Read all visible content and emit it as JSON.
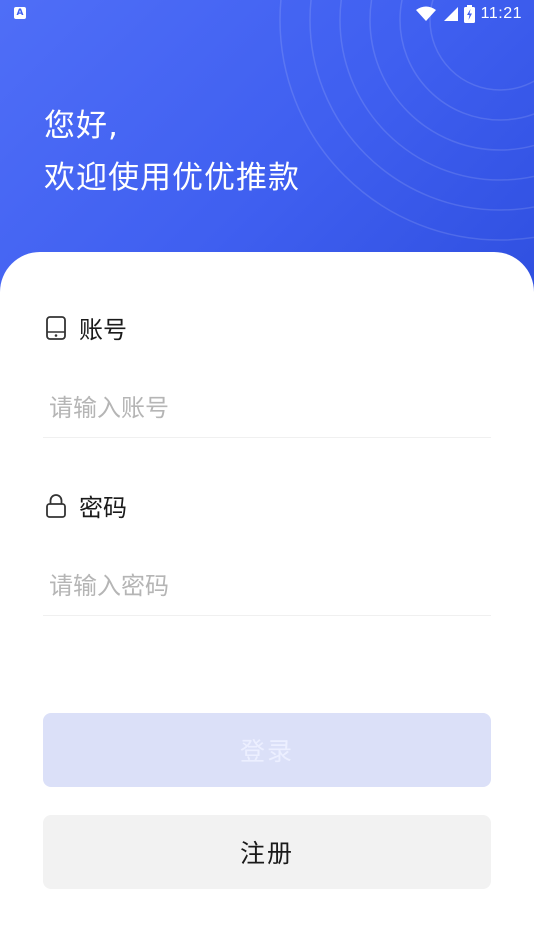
{
  "status_bar": {
    "notification_icon": "A",
    "time": "11:21",
    "icons": [
      "wifi-icon",
      "signal-icon",
      "battery-icon"
    ]
  },
  "header": {
    "greeting_line1": "您好,",
    "greeting_line2": "欢迎使用优优推款"
  },
  "form": {
    "account": {
      "label": "账号",
      "placeholder": "请输入账号",
      "value": "",
      "icon": "phone-icon"
    },
    "password": {
      "label": "密码",
      "placeholder": "请输入密码",
      "value": "",
      "icon": "lock-icon"
    }
  },
  "buttons": {
    "login_label": "登录",
    "register_label": "注册"
  },
  "colors": {
    "brand_blue": "#4f6ef7",
    "login_disabled_bg": "#dbe0f8",
    "register_bg": "#f2f2f2"
  }
}
